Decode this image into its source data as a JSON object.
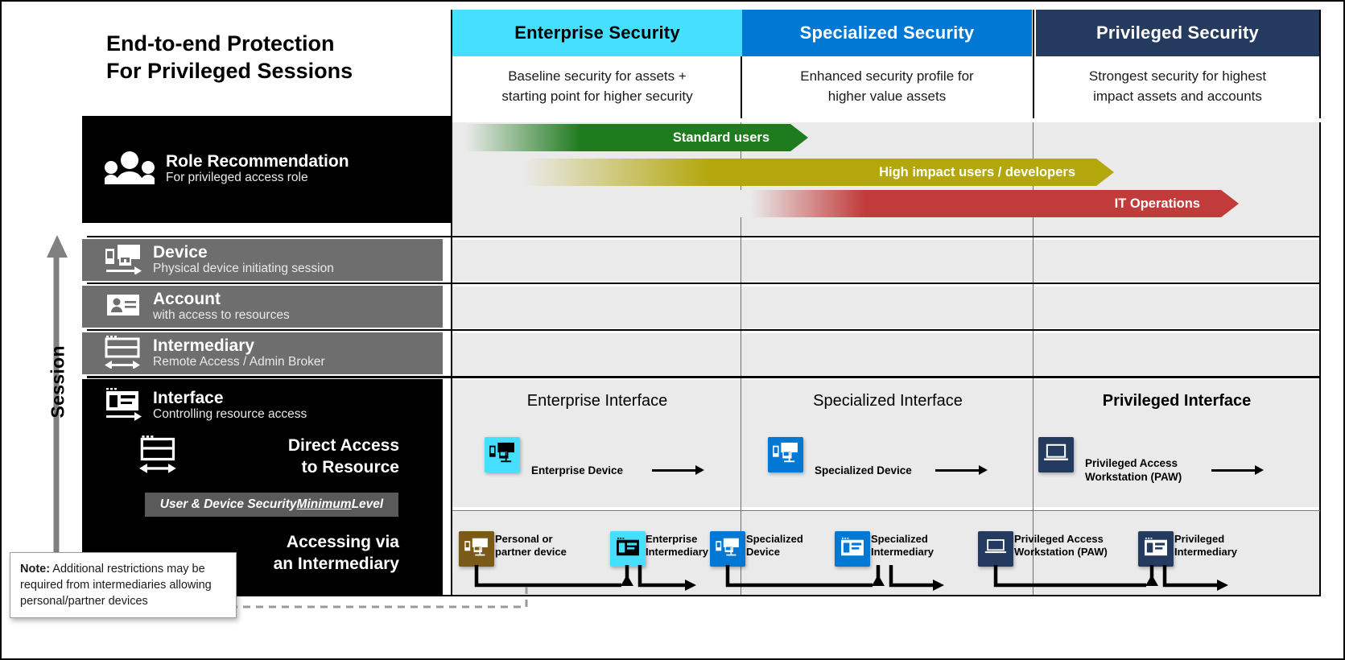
{
  "title": "End-to-end Protection\nFor Privileged Sessions",
  "title_line1": "End-to-end Protection",
  "title_line2": "For Privileged Sessions",
  "columns": [
    {
      "name": "Enterprise Security",
      "desc": "Baseline security for assets +\nstarting point for higher security",
      "desc_l1": "Baseline security for assets +",
      "desc_l2": "starting point for higher security",
      "color": "#45DFFF",
      "text_color": "#000000"
    },
    {
      "name": "Specialized Security",
      "desc": "Enhanced security profile for\nhigher value assets",
      "desc_l1": "Enhanced security profile for",
      "desc_l2": "higher value assets",
      "color": "#0078D4",
      "text_color": "#FFFFFF"
    },
    {
      "name": "Privileged Security",
      "desc": "Strongest security for highest\nimpact assets and accounts",
      "desc_l1": "Strongest security for highest",
      "desc_l2": "impact assets and accounts",
      "color": "#243A5E",
      "text_color": "#FFFFFF"
    }
  ],
  "rows": [
    {
      "id": "role",
      "title": "Role Recommendation",
      "subtitle": "For privileged access role",
      "icon": "people-icon",
      "bg": "#000000"
    },
    {
      "id": "device",
      "title": "Device",
      "subtitle": "Physical device initiating session",
      "icon": "device-arrow-icon",
      "bg": "#6E6E6E"
    },
    {
      "id": "account",
      "title": "Account",
      "subtitle": "with access to resources",
      "icon": "id-card-icon",
      "bg": "#6E6E6E"
    },
    {
      "id": "intermediary",
      "title": "Intermediary",
      "subtitle": "Remote Access / Admin Broker",
      "icon": "window-dualarrow-icon",
      "bg": "#6E6E6E"
    },
    {
      "id": "interface",
      "title": "Interface",
      "subtitle": "Controlling resource access",
      "icon": "window-arrow-icon",
      "bg": "#000000"
    }
  ],
  "role_arrows": [
    {
      "label": "Standard users",
      "color": "#1E7B1E"
    },
    {
      "label": "High impact users / developers",
      "color": "#B3A70B"
    },
    {
      "label": "IT Operations",
      "color": "#C23B3B"
    }
  ],
  "direct_access": {
    "heading_l1": "Direct Access",
    "heading_l2": "to Resource",
    "icon": "window-dualarrow-icon",
    "min_level_prefix": "User & Device Security ",
    "min_level_underlined": "Minimum",
    "min_level_suffix": " Level",
    "cells": [
      {
        "title": "Enterprise Interface",
        "device_label": "Enterprise Device",
        "device_label_l1": "Enterprise Device",
        "device_label_l2": "",
        "icon": "device-icon",
        "tile_color": "#45DFFF",
        "glyph_color": "#000000"
      },
      {
        "title": "Specialized Interface",
        "device_label": "Specialized Device",
        "device_label_l1": "Specialized Device",
        "device_label_l2": "",
        "icon": "device-icon",
        "tile_color": "#0078D4",
        "glyph_color": "#FFFFFF"
      },
      {
        "title": "Privileged Interface",
        "device_label": "Privileged Access Workstation (PAW)",
        "device_label_l1": "Privileged Access",
        "device_label_l2": "Workstation (PAW)",
        "icon": "laptop-icon",
        "tile_color": "#243A5E",
        "glyph_color": "#FFFFFF"
      }
    ]
  },
  "intermediary_access": {
    "heading_l1": "Accessing via",
    "heading_l2": "an Intermediary",
    "cells": [
      {
        "device_l1": "Personal or",
        "device_l2": "partner device",
        "device_icon": "device-icon",
        "device_tile_color": "#7A5A16",
        "device_glyph_color": "#FFFFFF",
        "inter_l1": "Enterprise",
        "inter_l2": "Intermediary",
        "inter_icon": "window-icon",
        "inter_tile_color": "#45DFFF",
        "inter_glyph_color": "#000000"
      },
      {
        "device_l1": "Specialized",
        "device_l2": "Device",
        "device_icon": "device-icon",
        "device_tile_color": "#0078D4",
        "device_glyph_color": "#FFFFFF",
        "inter_l1": "Specialized",
        "inter_l2": "Intermediary",
        "inter_icon": "window-icon",
        "inter_tile_color": "#0078D4",
        "inter_glyph_color": "#FFFFFF"
      },
      {
        "device_l1": "Privileged Access",
        "device_l2": "Workstation (PAW)",
        "device_icon": "laptop-icon",
        "device_tile_color": "#243A5E",
        "device_glyph_color": "#FFFFFF",
        "inter_l1": "Privileged",
        "inter_l2": "Intermediary",
        "inter_icon": "window-icon",
        "inter_tile_color": "#243A5E",
        "inter_glyph_color": "#FFFFFF"
      }
    ]
  },
  "note": {
    "bold": "Note:",
    "text": " Additional restrictions may be required from intermediaries allowing personal/partner devices"
  },
  "session_axis": {
    "label": "Session",
    "arrow": "up-arrow-icon",
    "color": "#808080"
  }
}
